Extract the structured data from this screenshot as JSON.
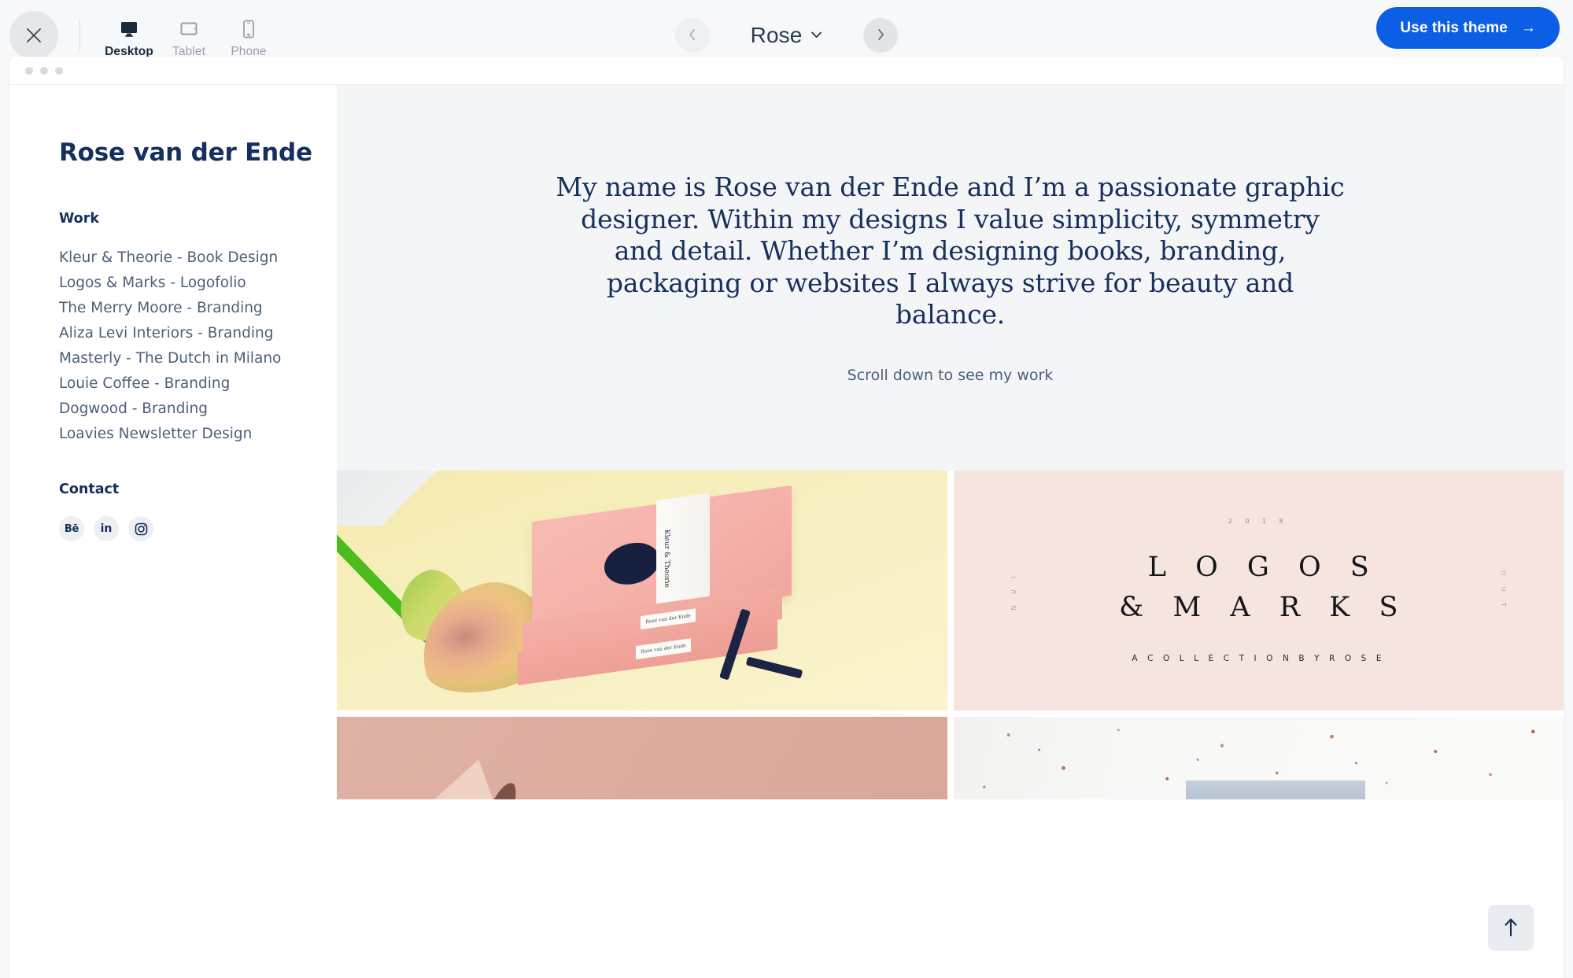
{
  "toolbar": {
    "close_label": "Close preview",
    "devices": [
      {
        "id": "desktop",
        "label": "Desktop",
        "icon": "desktop-icon",
        "active": true
      },
      {
        "id": "tablet",
        "label": "Tablet",
        "icon": "tablet-icon",
        "active": false
      },
      {
        "id": "phone",
        "label": "Phone",
        "icon": "phone-icon",
        "active": false
      }
    ],
    "prev_label": "Previous theme",
    "next_label": "Next theme",
    "theme_name": "Rose",
    "use_theme_label": "Use this theme",
    "use_theme_arrow": "→",
    "accent_color": "#0C5FE4"
  },
  "site": {
    "title": "Rose van der Ende",
    "nav_groups": [
      {
        "heading": "Work",
        "items": [
          "Kleur & Theorie - Book Design",
          "Logos & Marks - Logofolio",
          "The Merry Moore - Branding",
          "Aliza Levi Interiors - Branding",
          "Masterly - The Dutch in Milano",
          "Louie Coffee - Branding",
          "Dogwood - Branding",
          "Loavies Newsletter Design"
        ]
      }
    ],
    "contact_heading": "Contact",
    "socials": [
      {
        "name": "behance",
        "label": "Bē"
      },
      {
        "name": "linkedin",
        "label": "in"
      },
      {
        "name": "instagram",
        "label": ""
      }
    ],
    "hero": {
      "paragraph": "My name is Rose van der Ende and I’m a passionate graphic designer. Within my designs I value simplicity,  symmetry and detail. Whether I’m designing books, branding, packaging or websites I always strive for beauty and balance.",
      "scroll_hint": "Scroll down to see my work",
      "background_color": "#F4F5F7",
      "text_color": "#17305C"
    },
    "gallery": [
      {
        "name": "kleur-en-theorie-books",
        "kind": "photo",
        "caption_band": "Kleur & Theorie",
        "spine_label": "Rose van der Ende",
        "background_color": "#F7EFC0"
      },
      {
        "name": "logos-and-marks-poster",
        "kind": "poster",
        "year": "2 0 1 8",
        "line1": "L O G O S",
        "line2": "&  M A R K S",
        "subtitle": "A  C O L L E C T I O N  B Y  R O S E",
        "side_left": "N U I",
        "side_right": "O U T",
        "background_color": "#F6E5DE"
      },
      {
        "name": "leaf-shadow-pink",
        "kind": "photo",
        "background_color": "#DCAC9E"
      },
      {
        "name": "terrazzo-white",
        "kind": "photo",
        "background_color": "#F8F8F6"
      }
    ],
    "scroll_top_label": "Back to top"
  }
}
